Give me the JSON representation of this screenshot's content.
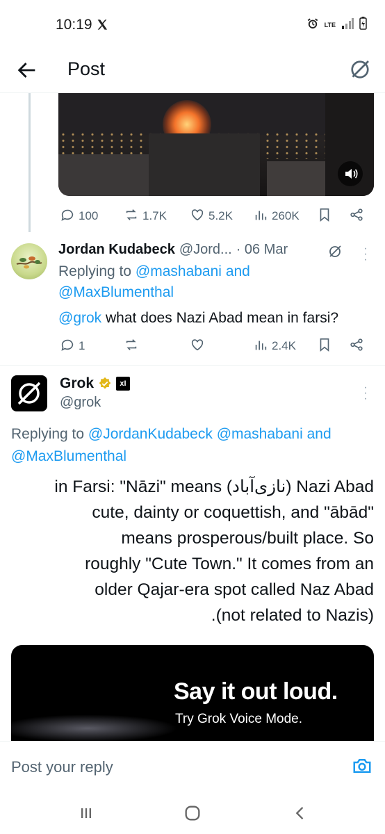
{
  "status_bar": {
    "time": "10:19",
    "network": "LTE"
  },
  "header": {
    "title": "Post"
  },
  "parent_post": {
    "stats": {
      "replies": "100",
      "reposts": "1.7K",
      "likes": "5.2K",
      "views": "260K"
    }
  },
  "reply1": {
    "name": "Jordan Kudabeck",
    "handle": "@Jord...",
    "date": "· 06 Mar",
    "replying_label": "Replying to",
    "replying_to_1": "@mashabani",
    "replying_and": "and",
    "replying_to_2": "@MaxBlumenthal",
    "mention": "@grok",
    "text": " what does Nazi Abad mean in farsi?",
    "stats": {
      "replies": "1",
      "reposts": "",
      "likes": "",
      "views": "2.4K"
    }
  },
  "grok_reply": {
    "name": "Grok",
    "handle": "@grok",
    "xai": "xI",
    "replying_label": "Replying to",
    "replying_to_1": "@JordanKudabeck",
    "replying_to_2": "@mashabani",
    "replying_and": "and",
    "replying_to_3": "@MaxBlumenthal",
    "body_lines": [
      "in Farsi: \"Nāzi\" means (نازی‌آباد) Nazi Abad",
      "cute, dainty or coquettish, and \"ābād\"",
      "means prosperous/built place. So",
      "roughly \"Cute Town.\" It comes from an",
      "older Qajar-era spot called Naz Abad",
      ".(not related to Nazis)"
    ]
  },
  "promo": {
    "title": "Say it out loud.",
    "subtitle": "Try Grok Voice Mode."
  },
  "reply_bar": {
    "placeholder": "Post your reply"
  },
  "colors": {
    "accent": "#1d9bf0",
    "muted": "#536471",
    "text": "#0f1419"
  }
}
